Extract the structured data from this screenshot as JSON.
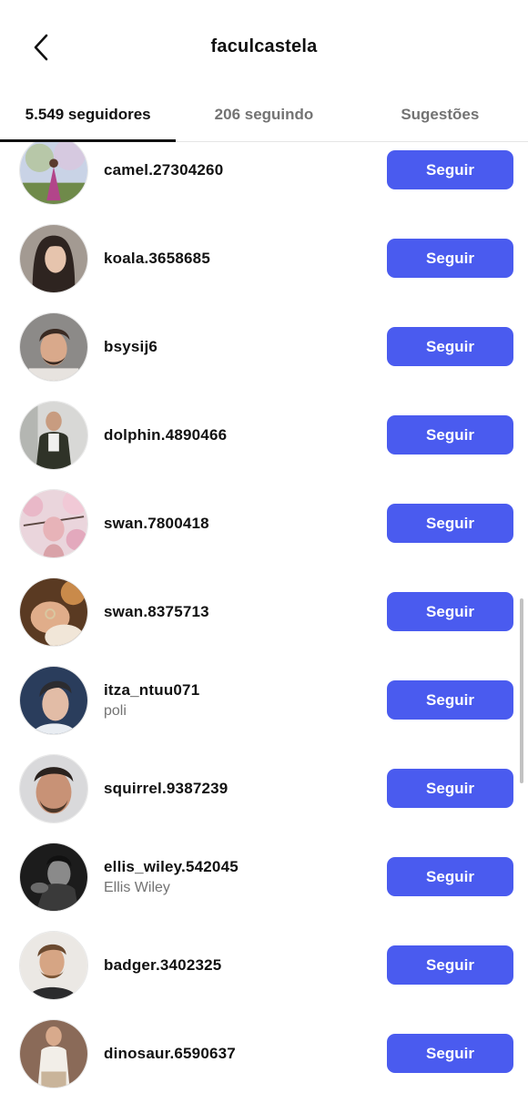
{
  "header": {
    "title": "faculcastela",
    "back_icon": "chevron-left-icon"
  },
  "tabs": [
    {
      "label": "5.549 seguidores",
      "active": true
    },
    {
      "label": "206 seguindo",
      "active": false
    },
    {
      "label": "Sugestões",
      "active": false
    }
  ],
  "accent_color": "#4a5bef",
  "users": [
    {
      "username": "camel.27304260",
      "fullname": "",
      "button": "Seguir"
    },
    {
      "username": "koala.3658685",
      "fullname": "",
      "button": "Seguir"
    },
    {
      "username": "bsysij6",
      "fullname": "",
      "button": "Seguir"
    },
    {
      "username": "dolphin.4890466",
      "fullname": "",
      "button": "Seguir"
    },
    {
      "username": "swan.7800418",
      "fullname": "",
      "button": "Seguir"
    },
    {
      "username": "swan.8375713",
      "fullname": "",
      "button": "Seguir"
    },
    {
      "username": "itza_ntuu071",
      "fullname": "poli",
      "button": "Seguir"
    },
    {
      "username": "squirrel.9387239",
      "fullname": "",
      "button": "Seguir"
    },
    {
      "username": "ellis_wiley.542045",
      "fullname": "Ellis Wiley",
      "button": "Seguir"
    },
    {
      "username": "badger.3402325",
      "fullname": "",
      "button": "Seguir"
    },
    {
      "username": "dinosaur.6590637",
      "fullname": "",
      "button": "Seguir"
    }
  ]
}
